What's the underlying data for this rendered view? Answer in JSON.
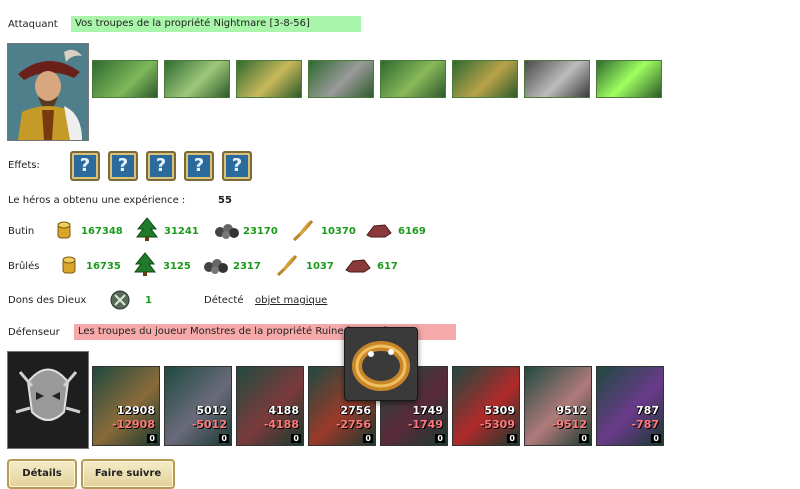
{
  "attacker": {
    "label": "Attaquant",
    "banner": "Vos troupes de la propriété Nightmare [3-8-56]",
    "banner_color": "#a9f5a9"
  },
  "effects": {
    "label": "Effets:",
    "count": 5,
    "icon": "question-icon"
  },
  "experience": {
    "label": "Le héros a obtenu une expérience :",
    "value": "55"
  },
  "loot": {
    "label": "Butin",
    "gold": "167348",
    "wood": "31241",
    "ore": "23170",
    "wheat": "10370",
    "stone": "6169"
  },
  "burned": {
    "label": "Brûlés",
    "gold": "16735",
    "wood": "3125",
    "ore": "2317",
    "wheat": "1037",
    "stone": "617"
  },
  "gifts": {
    "label": "Dons des Dieux",
    "value": "1",
    "detected_label": "Détecté",
    "detected_link": "objet magique"
  },
  "defender": {
    "label": "Défenseur",
    "banner": "Les troupes du joueur Monstres de la propriété Ruine [3-8-26]",
    "banner_color": "#f5a9a9",
    "units": [
      {
        "count": "12908",
        "loss": "-12908",
        "extra": "0"
      },
      {
        "count": "5012",
        "loss": "-5012",
        "extra": "0"
      },
      {
        "count": "4188",
        "loss": "-4188",
        "extra": "0"
      },
      {
        "count": "2756",
        "loss": "-2756",
        "extra": "0"
      },
      {
        "count": "1749",
        "loss": "-1749",
        "extra": "0"
      },
      {
        "count": "5309",
        "loss": "-5309",
        "extra": "0"
      },
      {
        "count": "9512",
        "loss": "-9512",
        "extra": "0"
      },
      {
        "count": "787",
        "loss": "-787",
        "extra": "0"
      }
    ]
  },
  "buttons": {
    "details": "Détails",
    "follow": "Faire suivre"
  },
  "colors": {
    "positive": "#1a9a1a",
    "loss": "#ff7a7a"
  }
}
